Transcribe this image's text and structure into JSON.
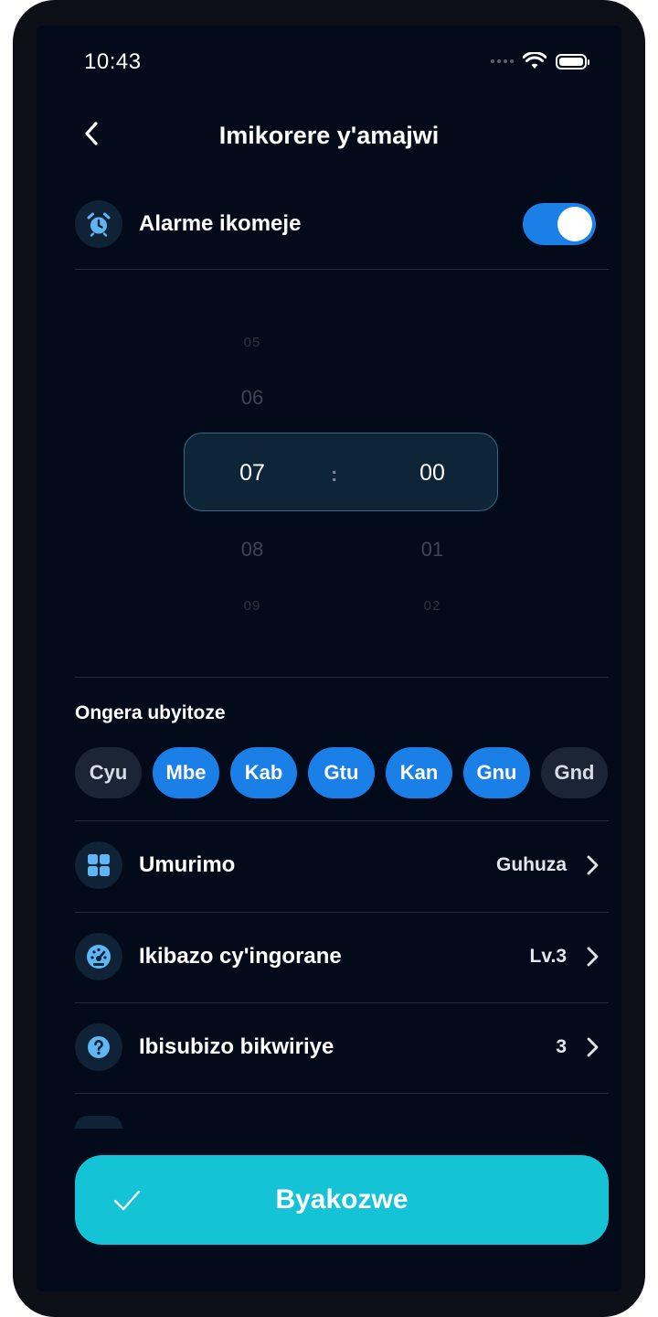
{
  "status_bar": {
    "time": "10:43"
  },
  "header": {
    "title": "Imikorere y'amajwi"
  },
  "alarm": {
    "label": "Alarme ikomeje",
    "enabled": true,
    "icon": "alarm-clock-icon"
  },
  "time_picker": {
    "hours": {
      "far_above": "05",
      "above": "06",
      "selected": "07",
      "below": "08",
      "far_below": "09"
    },
    "minutes": {
      "selected": "00",
      "below": "01",
      "far_below": "02"
    },
    "separator": ":"
  },
  "repeat": {
    "label": "Ongera ubyitoze",
    "days": [
      {
        "label": "Cyu",
        "selected": false
      },
      {
        "label": "Mbe",
        "selected": true
      },
      {
        "label": "Kab",
        "selected": true
      },
      {
        "label": "Gtu",
        "selected": true
      },
      {
        "label": "Kan",
        "selected": true
      },
      {
        "label": "Gnu",
        "selected": true
      },
      {
        "label": "Gnd",
        "selected": false
      }
    ]
  },
  "settings": [
    {
      "label": "Umurimo",
      "value": "Guhuza",
      "icon": "grid-icon"
    },
    {
      "label": "Ikibazo cy'ingorane",
      "value": "Lv.3",
      "icon": "speedometer-icon"
    },
    {
      "label": "Ibisubizo bikwiriye",
      "value": "3",
      "icon": "question-icon"
    }
  ],
  "done_button": {
    "label": "Byakozwe"
  },
  "colors": {
    "accent": "#1a7fe6",
    "done": "#14c3d6",
    "background": "#030a1a",
    "icon": "#5fb6f5"
  }
}
